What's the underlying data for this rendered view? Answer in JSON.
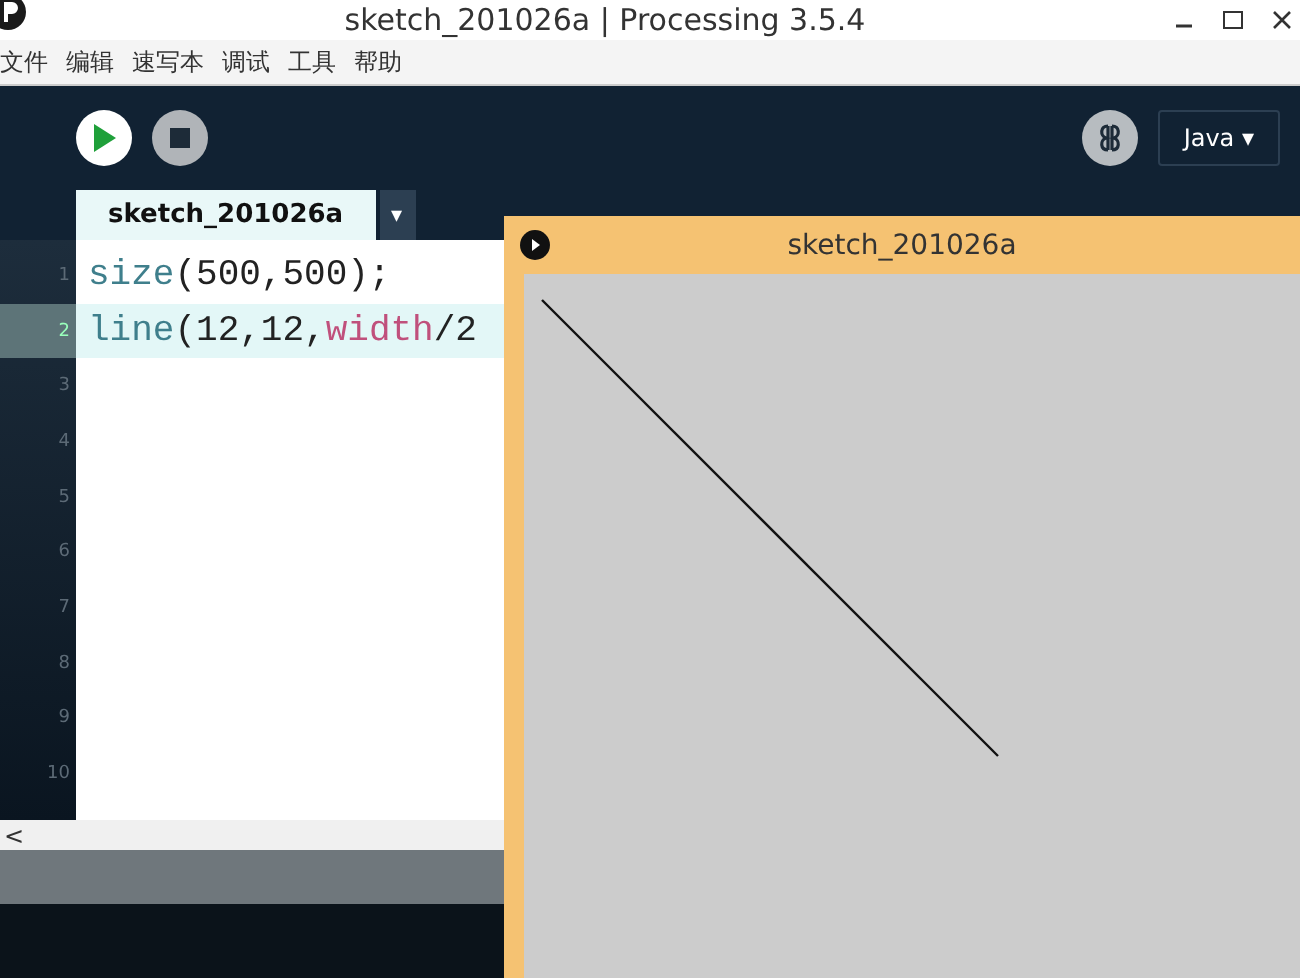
{
  "window": {
    "title": "sketch_201026a | Processing 3.5.4"
  },
  "menu": [
    "文件",
    "编辑",
    "速写本",
    "调试",
    "工具",
    "帮助"
  ],
  "mode": {
    "label": "Java ▾"
  },
  "tabs": [
    {
      "label": "sketch_201026a",
      "selected": true
    }
  ],
  "tab_menu": "▾",
  "editor": {
    "lines": [
      {
        "number": "1",
        "current": false,
        "tokens": [
          {
            "text": "size",
            "kind": "function"
          },
          {
            "text": "(500,500);",
            "kind": "plain"
          }
        ]
      },
      {
        "number": "2",
        "current": true,
        "tokens": [
          {
            "text": "line",
            "kind": "function"
          },
          {
            "text": "(12,12,",
            "kind": "plain"
          },
          {
            "text": "width",
            "kind": "variable"
          },
          {
            "text": "/2",
            "kind": "plain"
          }
        ]
      },
      {
        "number": "3",
        "current": false
      },
      {
        "number": "4",
        "current": false
      },
      {
        "number": "5",
        "current": false
      },
      {
        "number": "6",
        "current": false
      },
      {
        "number": "7",
        "current": false
      },
      {
        "number": "8",
        "current": false
      },
      {
        "number": "9",
        "current": false
      },
      {
        "number": "10",
        "current": false
      }
    ],
    "scroll_left": "<"
  },
  "sketch_window": {
    "title": "sketch_201026a"
  }
}
